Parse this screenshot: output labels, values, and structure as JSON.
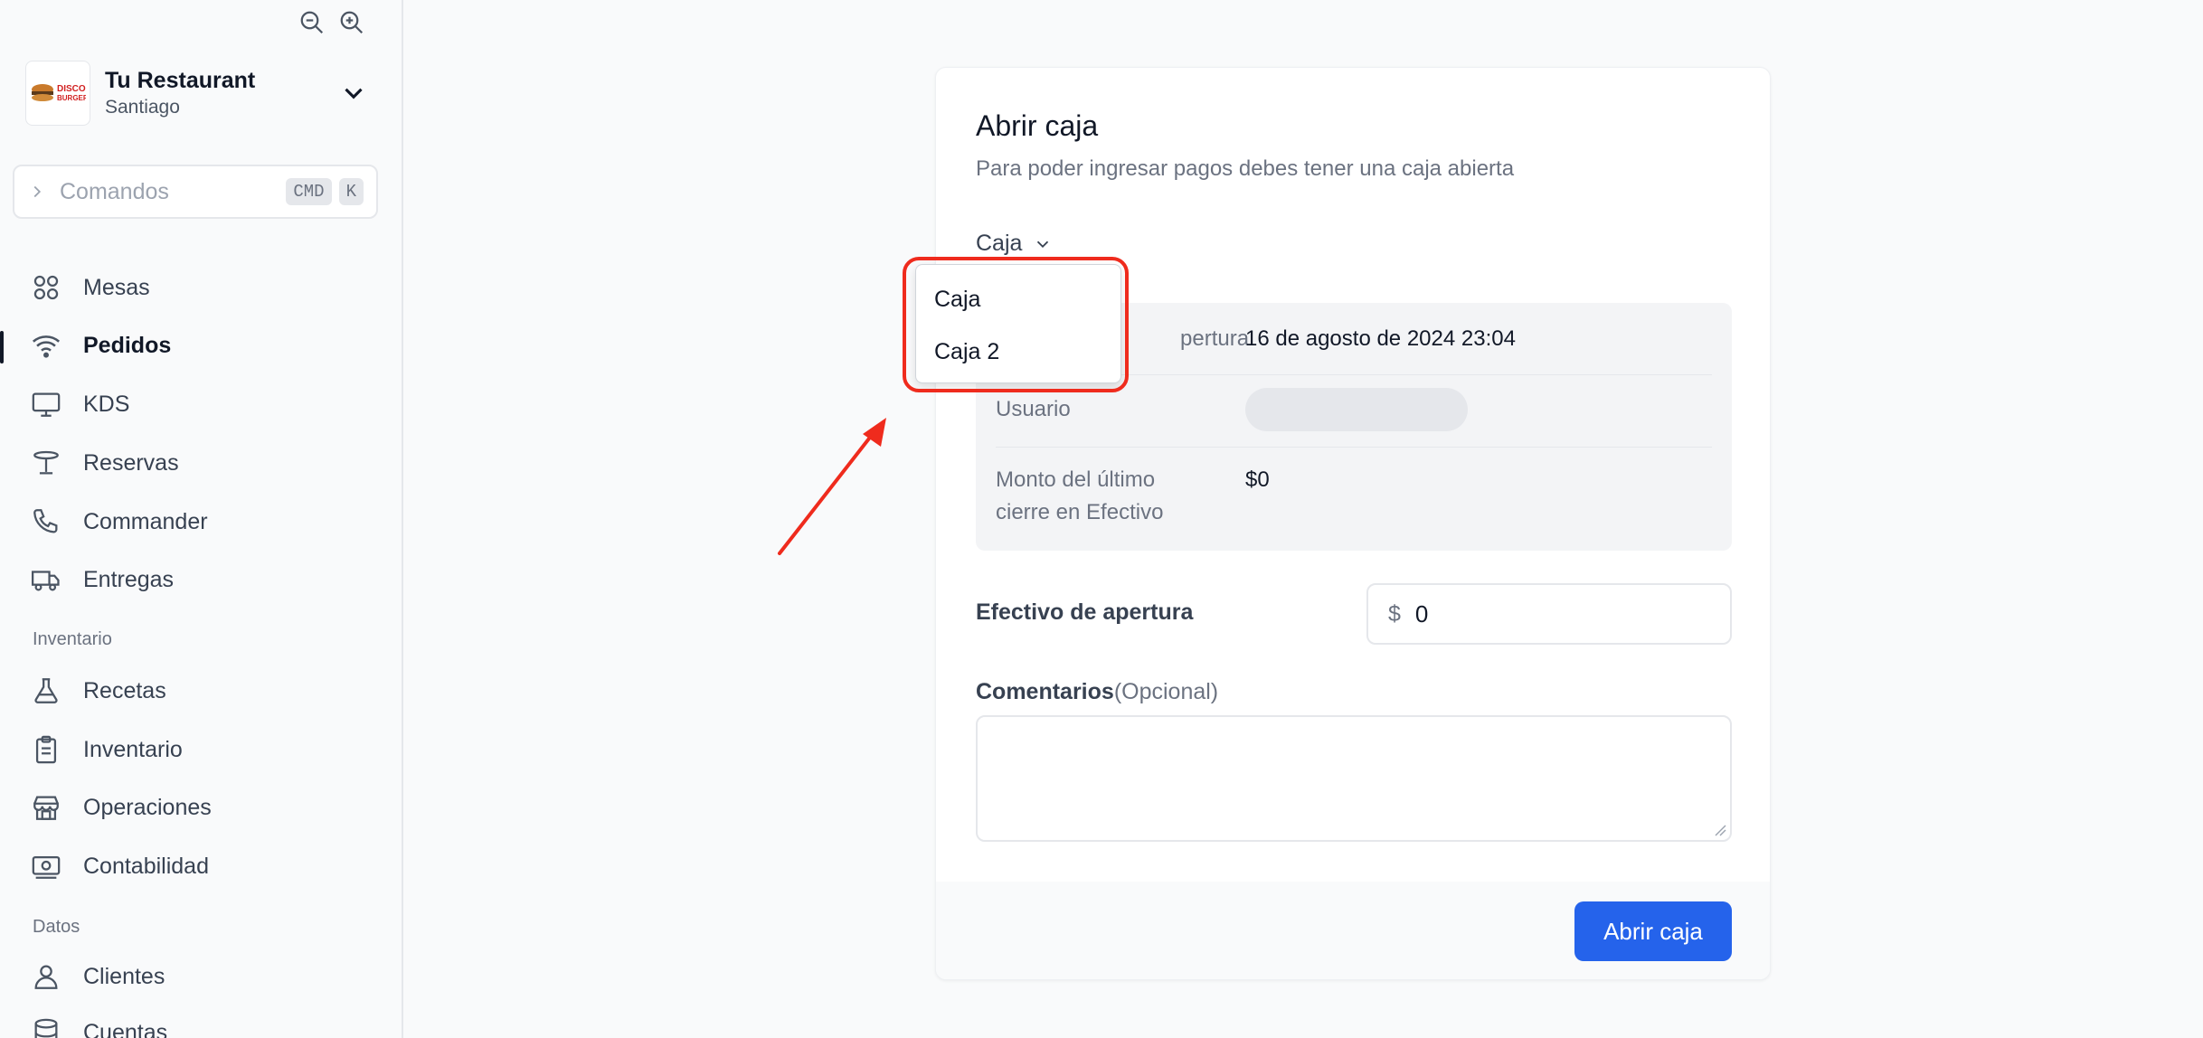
{
  "sidebar": {
    "brand": {
      "name": "Tu Restaurant",
      "city": "Santiago",
      "logo_text": [
        "DISCO",
        "BURGER"
      ]
    },
    "command": {
      "placeholder": "Comandos",
      "key1": "CMD",
      "key2": "K"
    },
    "items": [
      {
        "label": "Mesas",
        "icon": "grid-icon"
      },
      {
        "label": "Pedidos",
        "icon": "wifi-icon",
        "active": true
      },
      {
        "label": "KDS",
        "icon": "monitor-icon"
      },
      {
        "label": "Reservas",
        "icon": "table-icon"
      },
      {
        "label": "Commander",
        "icon": "phone-icon"
      },
      {
        "label": "Entregas",
        "icon": "truck-icon"
      }
    ],
    "section_inventario": "Inventario",
    "inventario_items": [
      {
        "label": "Recetas",
        "icon": "flask-icon"
      },
      {
        "label": "Inventario",
        "icon": "clipboard-icon"
      },
      {
        "label": "Operaciones",
        "icon": "store-icon"
      },
      {
        "label": "Contabilidad",
        "icon": "cash-icon"
      }
    ],
    "section_datos": "Datos",
    "datos_items": [
      {
        "label": "Clientes",
        "icon": "user-icon"
      },
      {
        "label": "Cuentas",
        "icon": "database-icon"
      }
    ]
  },
  "card": {
    "title": "Abrir caja",
    "subtitle": "Para poder ingresar pagos debes tener una caja abierta",
    "caja_select": {
      "label": "Caja"
    },
    "dropdown_options": [
      "Caja",
      "Caja 2"
    ],
    "info": {
      "apertura_label_visible": "Fecha de apertura",
      "apertura_label_partial": "pertura",
      "apertura_value": "16 de agosto de 2024 23:04",
      "usuario_label": "Usuario",
      "monto_label_line1": "Monto del último",
      "monto_label_line2": "cierre en Efectivo",
      "monto_value": "$0"
    },
    "efectivo": {
      "label": "Efectivo de apertura",
      "currency": "$",
      "value": "0"
    },
    "comentarios": {
      "label": "Comentarios",
      "optional": "(Opcional)",
      "value": ""
    },
    "submit": "Abrir caja"
  },
  "colors": {
    "primary": "#2563eb",
    "annotation": "#ef2b1d"
  }
}
